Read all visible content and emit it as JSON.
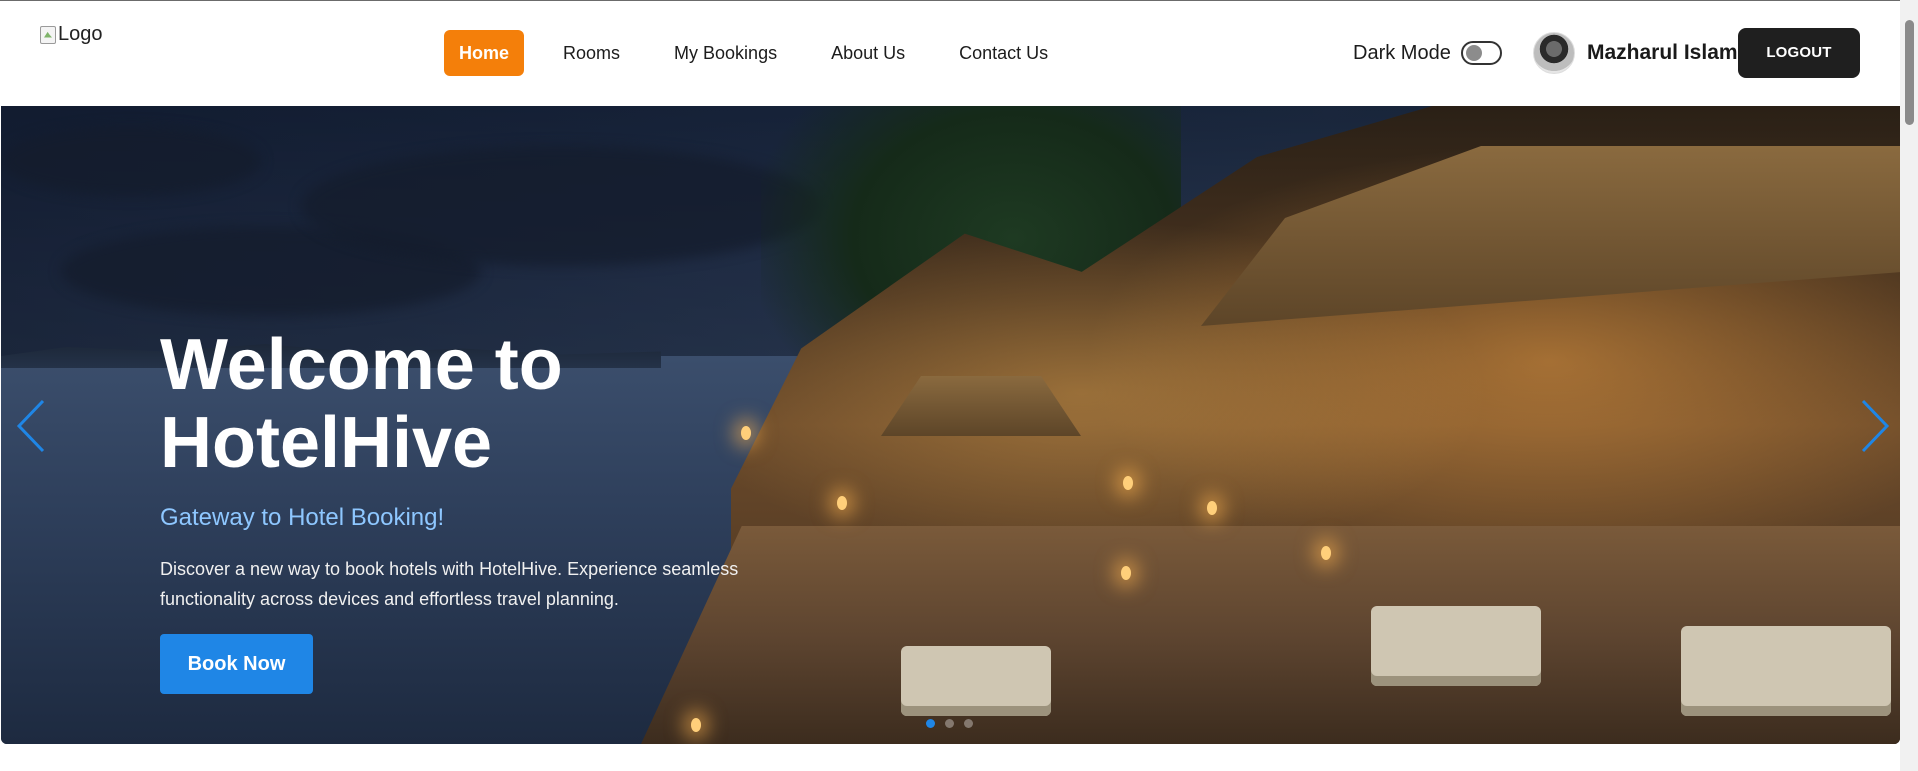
{
  "logo": {
    "alt": "Logo"
  },
  "nav": {
    "items": [
      {
        "label": "Home",
        "active": true
      },
      {
        "label": "Rooms",
        "active": false
      },
      {
        "label": "My Bookings",
        "active": false
      },
      {
        "label": "About Us",
        "active": false
      },
      {
        "label": "Contact Us",
        "active": false
      }
    ]
  },
  "dark_mode": {
    "label": "Dark Mode",
    "enabled": false
  },
  "user": {
    "name": "Mazharul Islam",
    "avatar_icon": "user-avatar-icon"
  },
  "logout_label": "LOGOUT",
  "hero": {
    "title_line1": "Welcome to",
    "title_line2": "HotelHive",
    "subtitle": "Gateway to Hotel Booking!",
    "description": "Discover a new way to book hotels with HotelHive. Experience seamless functionality across devices and effortless travel planning.",
    "cta_label": "Book Now",
    "slides": {
      "count": 3,
      "active_index": 0
    },
    "prev_icon": "chevron-left-icon",
    "next_icon": "chevron-right-icon"
  },
  "colors": {
    "accent_orange": "#f47f0a",
    "primary_blue": "#1f86e6",
    "subtitle_blue": "#8ec7ff",
    "logout_bg": "#1f1f1f"
  }
}
